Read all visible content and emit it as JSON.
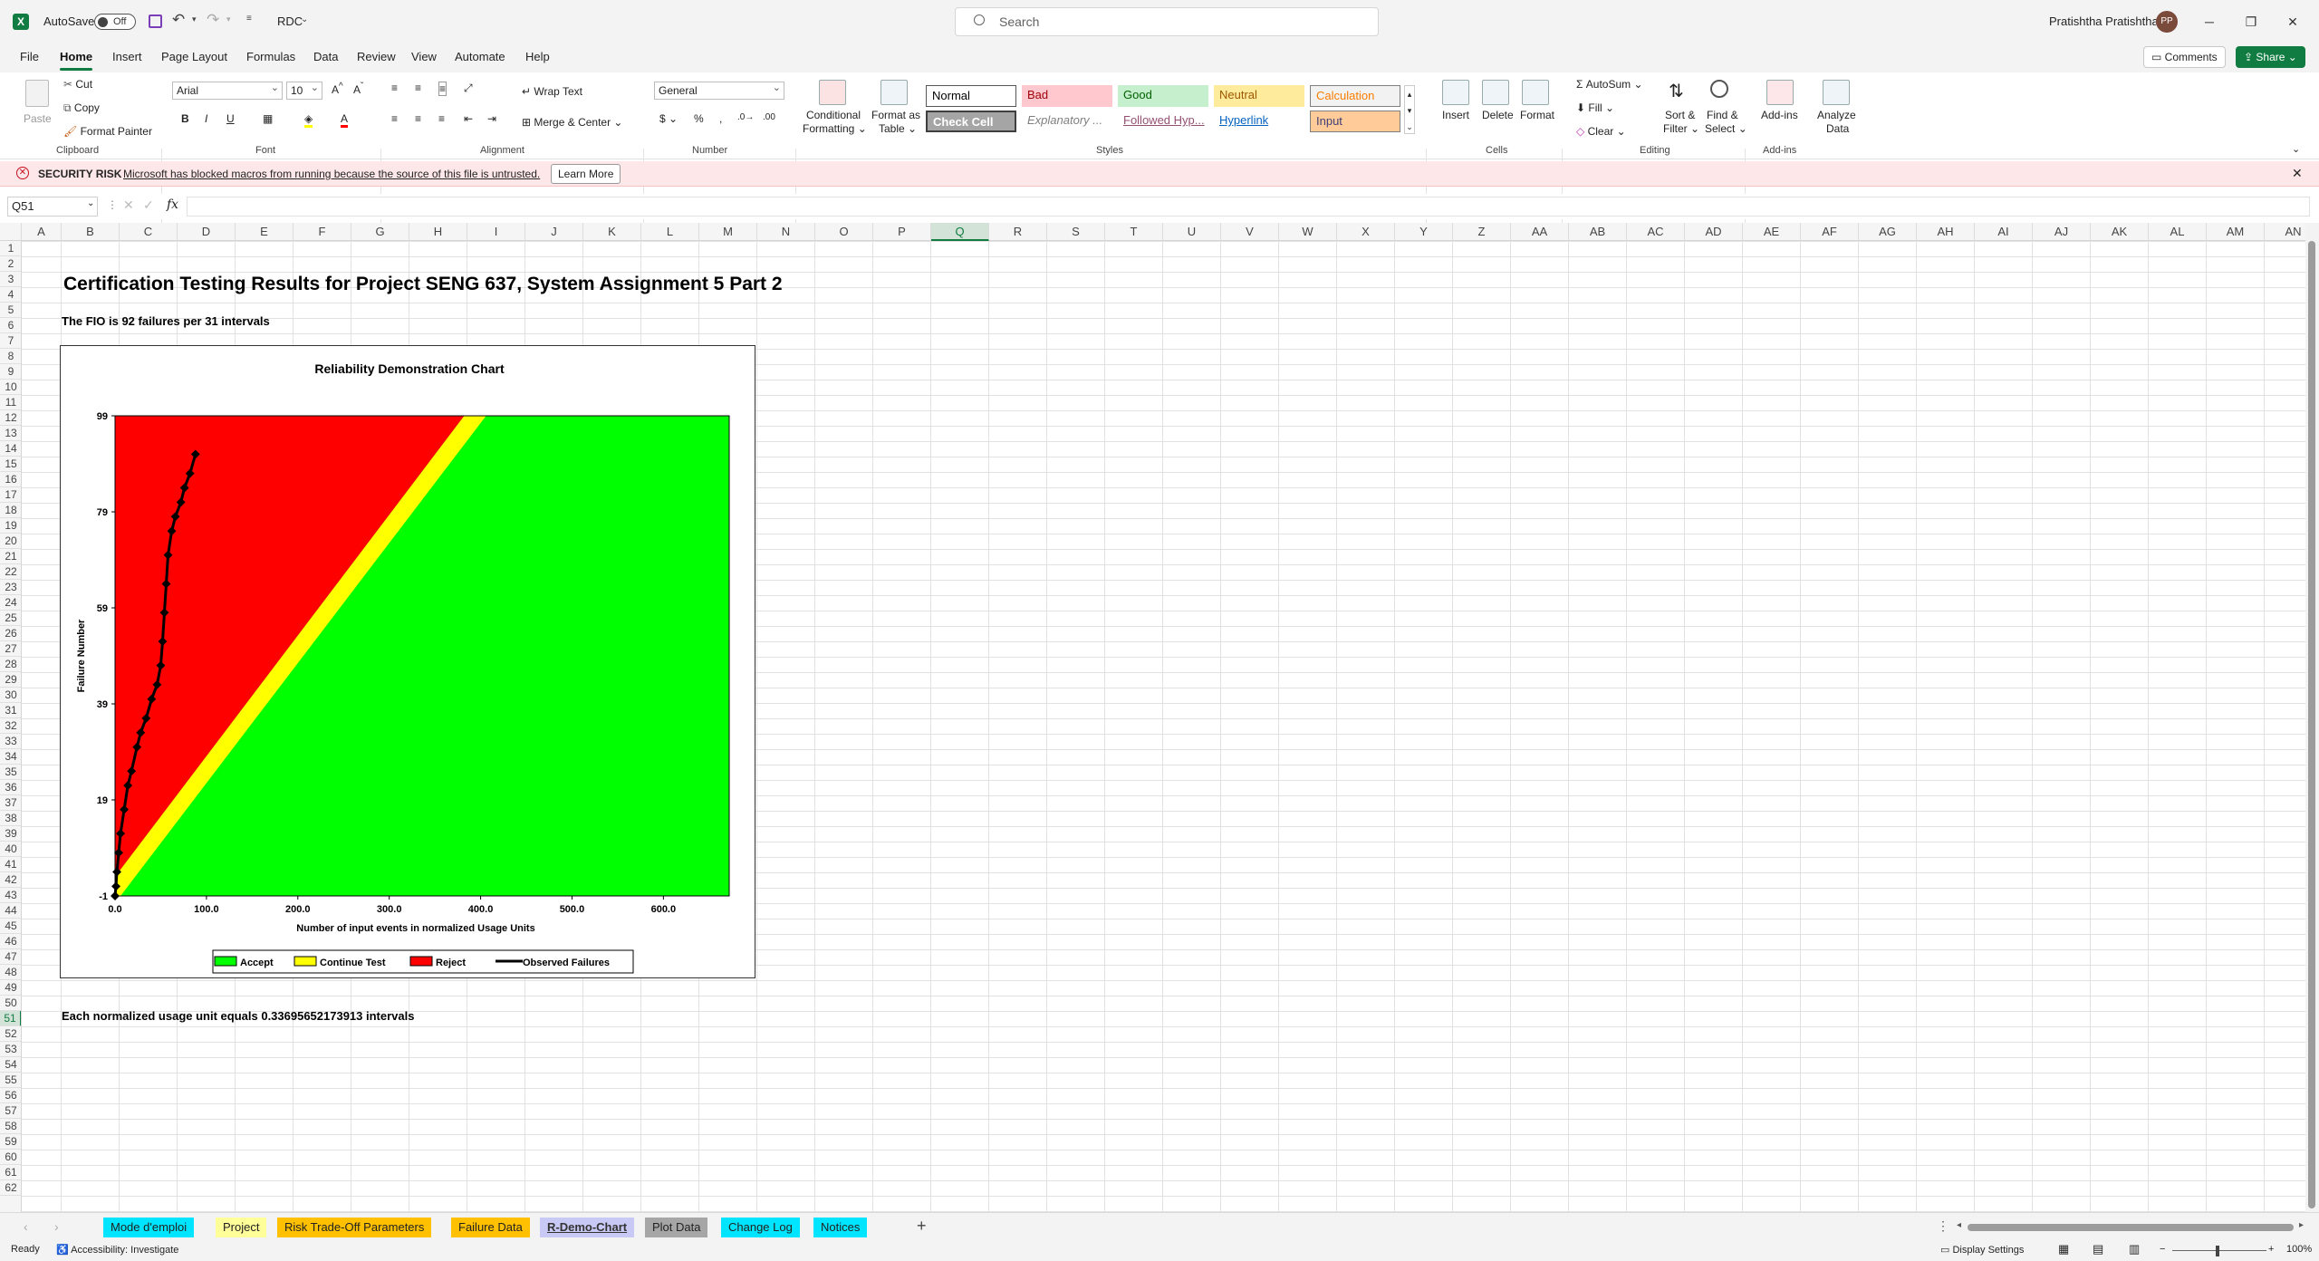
{
  "titlebar": {
    "autosave_label": "AutoSave",
    "autosave_state": "Off",
    "filename": "RDC",
    "search_placeholder": "Search",
    "user_name": "Pratishtha Pratishtha",
    "user_initials": "PP"
  },
  "menu": {
    "tabs": [
      "File",
      "Home",
      "Insert",
      "Page Layout",
      "Formulas",
      "Data",
      "Review",
      "View",
      "Automate",
      "Help"
    ],
    "active": "Home",
    "comments_label": "Comments",
    "share_label": "Share"
  },
  "ribbon": {
    "clipboard": {
      "paste": "Paste",
      "cut": "Cut",
      "copy": "Copy",
      "format_painter": "Format Painter",
      "group": "Clipboard"
    },
    "font": {
      "name": "Arial",
      "size": "10",
      "group": "Font"
    },
    "alignment": {
      "wrap": "Wrap Text",
      "merge": "Merge & Center",
      "group": "Alignment"
    },
    "number": {
      "format": "General",
      "group": "Number"
    },
    "styles": {
      "conditional": [
        "Conditional",
        "Formatting"
      ],
      "format_table": [
        "Format as",
        "Table"
      ],
      "items": [
        {
          "label": "Normal",
          "bg": "#ffffff",
          "fg": "#000000"
        },
        {
          "label": "Bad",
          "bg": "#ffc7ce",
          "fg": "#9c0006"
        },
        {
          "label": "Good",
          "bg": "#c6efce",
          "fg": "#006100"
        },
        {
          "label": "Neutral",
          "bg": "#ffeb9c",
          "fg": "#9c5700"
        },
        {
          "label": "Calculation",
          "bg": "#f2f2f2",
          "fg": "#fa7d00"
        },
        {
          "label": "Check Cell",
          "bg": "#a5a5a5",
          "fg": "#ffffff"
        },
        {
          "label": "Explanatory ...",
          "bg": "#ffffff",
          "fg": "#7f7f7f"
        },
        {
          "label": "Followed Hyp...",
          "bg": "#ffffff",
          "fg": "#954f72"
        },
        {
          "label": "Hyperlink",
          "bg": "#ffffff",
          "fg": "#0563c1"
        },
        {
          "label": "Input",
          "bg": "#ffcc99",
          "fg": "#3f3f76"
        }
      ],
      "group": "Styles"
    },
    "cells": {
      "insert": "Insert",
      "delete": "Delete",
      "format": "Format",
      "group": "Cells"
    },
    "editing": {
      "autosum": "AutoSum",
      "fill": "Fill",
      "clear": "Clear",
      "sort": [
        "Sort &",
        "Filter"
      ],
      "find": [
        "Find &",
        "Select"
      ],
      "group": "Editing"
    },
    "addins": {
      "addins": "Add-ins",
      "analyze": [
        "Analyze",
        "Data"
      ],
      "group": "Add-ins"
    }
  },
  "security": {
    "label": "SECURITY RISK",
    "message": "Microsoft has blocked macros from running because the source of this file is untrusted.",
    "button": "Learn More"
  },
  "formula_bar": {
    "name_box": "Q51",
    "fx": "fx",
    "content": ""
  },
  "columns": [
    "A",
    "B",
    "C",
    "D",
    "E",
    "F",
    "G",
    "H",
    "I",
    "J",
    "K",
    "L",
    "M",
    "N",
    "O",
    "P",
    "Q",
    "R",
    "S",
    "T",
    "U",
    "V",
    "W",
    "X",
    "Y",
    "Z",
    "AA",
    "AB",
    "AC",
    "AD",
    "AE",
    "AF",
    "AG",
    "AH",
    "AI",
    "AJ",
    "AK",
    "AL",
    "AM",
    "AN"
  ],
  "rows_count": 62,
  "sheet": {
    "title": "Certification Testing Results for Project SENG 637, System Assignment 5 Part 2",
    "fio": "The FIO is 92 failures per 31 intervals",
    "note": "Each normalized usage unit equals 0.33695652173913 intervals"
  },
  "chart_data": {
    "type": "area",
    "title": "Reliability Demonstration Chart",
    "xlabel": "Number of input events in normalized Usage Units",
    "ylabel": "Failure Number",
    "x_ticks": [
      "0.0",
      "100.0",
      "200.0",
      "300.0",
      "400.0",
      "500.0",
      "600.0"
    ],
    "y_ticks": [
      "-1",
      "19",
      "39",
      "59",
      "79",
      "99"
    ],
    "xlim": [
      0,
      672
    ],
    "ylim": [
      -1,
      99
    ],
    "regions": [
      {
        "name": "Accept",
        "color": "#00ff00"
      },
      {
        "name": "Continue Test",
        "color": "#ffff00"
      },
      {
        "name": "Reject",
        "color": "#ff0000"
      }
    ],
    "boundaries": {
      "reject_line": [
        [
          0,
          -1
        ],
        [
          0,
          3
        ],
        [
          382,
          99
        ]
      ],
      "accept_line": [
        [
          6,
          -1
        ],
        [
          406,
          99
        ]
      ]
    },
    "observed": {
      "name": "Observed Failures",
      "color": "#000000",
      "points": [
        [
          0,
          -1
        ],
        [
          1,
          1
        ],
        [
          2,
          4
        ],
        [
          4,
          8
        ],
        [
          6,
          12
        ],
        [
          10,
          17
        ],
        [
          14,
          22
        ],
        [
          18,
          25
        ],
        [
          24,
          30
        ],
        [
          28,
          33
        ],
        [
          34,
          36
        ],
        [
          40,
          40
        ],
        [
          46,
          43
        ],
        [
          50,
          47
        ],
        [
          52,
          52
        ],
        [
          54,
          58
        ],
        [
          56,
          64
        ],
        [
          58,
          70
        ],
        [
          62,
          75
        ],
        [
          66,
          78
        ],
        [
          72,
          81
        ],
        [
          76,
          84
        ],
        [
          82,
          87
        ],
        [
          88,
          91
        ]
      ]
    },
    "legend": [
      "Accept",
      "Continue Test",
      "Reject",
      "Observed Failures"
    ]
  },
  "sheet_tabs": [
    {
      "label": "Mode d'emploi",
      "color": "#00e5ff"
    },
    {
      "label": "Project",
      "color": "#ffff99"
    },
    {
      "label": "Risk Trade-Off Parameters",
      "color": "#ffc000"
    },
    {
      "label": "Failure Data",
      "color": "#ffc000"
    },
    {
      "label": "R-Demo-Chart",
      "color": "#c9c9f5"
    },
    {
      "label": "Plot Data",
      "color": "#a6a6a6"
    },
    {
      "label": "Change Log",
      "color": "#00e5ff"
    },
    {
      "label": "Notices",
      "color": "#00e5ff"
    }
  ],
  "active_sheet": "R-Demo-Chart",
  "status": {
    "ready": "Ready",
    "accessibility": "Accessibility: Investigate",
    "display": "Display Settings",
    "zoom": "100%"
  }
}
